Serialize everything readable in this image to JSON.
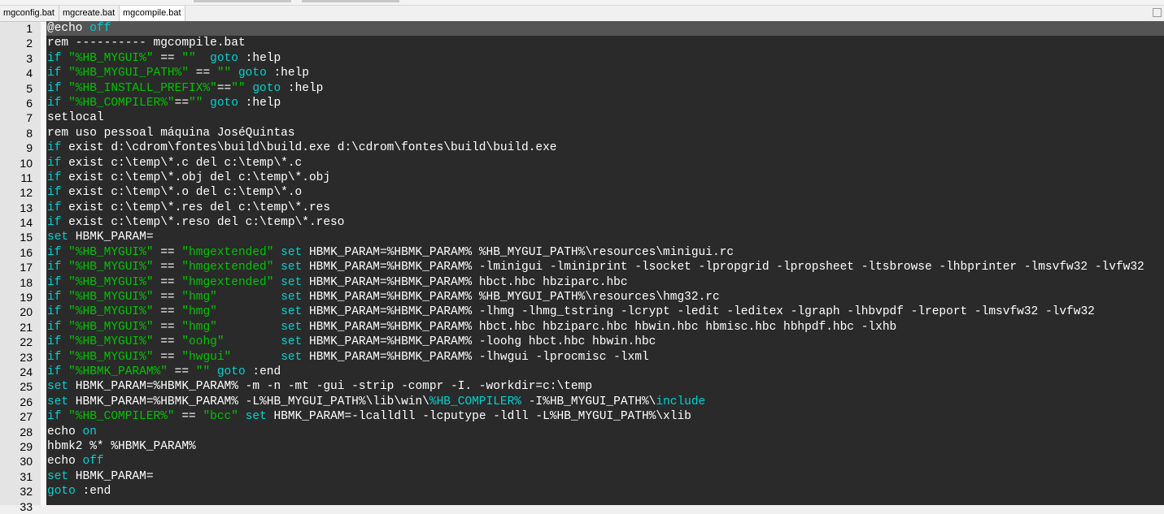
{
  "tabs": [
    {
      "label": "mgconfig.bat",
      "active": false
    },
    {
      "label": "mgcreate.bat",
      "active": false
    },
    {
      "label": "mgcompile.bat",
      "active": true
    }
  ],
  "colors": {
    "background": "#2a2a2a",
    "keyword": "#00d2d2",
    "string": "#00c400",
    "text": "#ffffff",
    "current_line": "#545454"
  },
  "editor": {
    "current_line": 1,
    "lines": [
      [
        [
          "w",
          "@echo "
        ],
        [
          "k",
          "off"
        ]
      ],
      [
        [
          "w",
          "rem ---------- mgcompile.bat"
        ]
      ],
      [
        [
          "k",
          "if"
        ],
        [
          "s",
          " \"%HB_MYGUI%\""
        ],
        [
          "w",
          " == "
        ],
        [
          "s",
          "\"\""
        ],
        [
          "w",
          "  "
        ],
        [
          "k",
          "goto"
        ],
        [
          "w",
          " :help"
        ]
      ],
      [
        [
          "k",
          "if"
        ],
        [
          "s",
          " \"%HB_MYGUI_PATH%\""
        ],
        [
          "w",
          " == "
        ],
        [
          "s",
          "\"\""
        ],
        [
          "w",
          " "
        ],
        [
          "k",
          "goto"
        ],
        [
          "w",
          " :help"
        ]
      ],
      [
        [
          "k",
          "if"
        ],
        [
          "s",
          " \"%HB_INSTALL_PREFIX%\""
        ],
        [
          "w",
          "=="
        ],
        [
          "s",
          "\"\""
        ],
        [
          "w",
          " "
        ],
        [
          "k",
          "goto"
        ],
        [
          "w",
          " :help"
        ]
      ],
      [
        [
          "k",
          "if"
        ],
        [
          "s",
          " \"%HB_COMPILER%\""
        ],
        [
          "w",
          "=="
        ],
        [
          "s",
          "\"\""
        ],
        [
          "w",
          " "
        ],
        [
          "k",
          "goto"
        ],
        [
          "w",
          " :help"
        ]
      ],
      [
        [
          "w",
          "setlocal"
        ]
      ],
      [
        [
          "w",
          "rem uso pessoal máquina JoséQuintas"
        ]
      ],
      [
        [
          "k",
          "if"
        ],
        [
          "w",
          " exist d:\\cdrom\\fontes\\build\\build.exe d:\\cdrom\\fontes\\build\\build.exe"
        ]
      ],
      [
        [
          "k",
          "if"
        ],
        [
          "w",
          " exist c:\\temp\\*.c del c:\\temp\\*.c"
        ]
      ],
      [
        [
          "k",
          "if"
        ],
        [
          "w",
          " exist c:\\temp\\*.obj del c:\\temp\\*.obj"
        ]
      ],
      [
        [
          "k",
          "if"
        ],
        [
          "w",
          " exist c:\\temp\\*.o del c:\\temp\\*.o"
        ]
      ],
      [
        [
          "k",
          "if"
        ],
        [
          "w",
          " exist c:\\temp\\*.res del c:\\temp\\*.res"
        ]
      ],
      [
        [
          "k",
          "if"
        ],
        [
          "w",
          " exist c:\\temp\\*.reso del c:\\temp\\*.reso"
        ]
      ],
      [
        [
          "k",
          "set"
        ],
        [
          "w",
          " HBMK_PARAM="
        ]
      ],
      [
        [
          "k",
          "if"
        ],
        [
          "s",
          " \"%HB_MYGUI%\""
        ],
        [
          "w",
          " == "
        ],
        [
          "s",
          "\"hmgextended\""
        ],
        [
          "w",
          " "
        ],
        [
          "k",
          "set"
        ],
        [
          "w",
          " HBMK_PARAM=%HBMK_PARAM% %HB_MYGUI_PATH%\\resources\\minigui.rc"
        ]
      ],
      [
        [
          "k",
          "if"
        ],
        [
          "s",
          " \"%HB_MYGUI%\""
        ],
        [
          "w",
          " == "
        ],
        [
          "s",
          "\"hmgextended\""
        ],
        [
          "w",
          " "
        ],
        [
          "k",
          "set"
        ],
        [
          "w",
          " HBMK_PARAM=%HBMK_PARAM% -lminigui -lminiprint -lsocket -lpropgrid -lpropsheet -ltsbrowse -lhbprinter -lmsvfw32 -lvfw32"
        ]
      ],
      [
        [
          "k",
          "if"
        ],
        [
          "s",
          " \"%HB_MYGUI%\""
        ],
        [
          "w",
          " == "
        ],
        [
          "s",
          "\"hmgextended\""
        ],
        [
          "w",
          " "
        ],
        [
          "k",
          "set"
        ],
        [
          "w",
          " HBMK_PARAM=%HBMK_PARAM% hbct.hbc hbziparc.hbc"
        ]
      ],
      [
        [
          "k",
          "if"
        ],
        [
          "s",
          " \"%HB_MYGUI%\""
        ],
        [
          "w",
          " == "
        ],
        [
          "s",
          "\"hmg\""
        ],
        [
          "w",
          "         "
        ],
        [
          "k",
          "set"
        ],
        [
          "w",
          " HBMK_PARAM=%HBMK_PARAM% %HB_MYGUI_PATH%\\resources\\hmg32.rc"
        ]
      ],
      [
        [
          "k",
          "if"
        ],
        [
          "s",
          " \"%HB_MYGUI%\""
        ],
        [
          "w",
          " == "
        ],
        [
          "s",
          "\"hmg\""
        ],
        [
          "w",
          "         "
        ],
        [
          "k",
          "set"
        ],
        [
          "w",
          " HBMK_PARAM=%HBMK_PARAM% -lhmg -lhmg_tstring -lcrypt -ledit -leditex -lgraph -lhbvpdf -lreport -lmsvfw32 -lvfw32"
        ]
      ],
      [
        [
          "k",
          "if"
        ],
        [
          "s",
          " \"%HB_MYGUI%\""
        ],
        [
          "w",
          " == "
        ],
        [
          "s",
          "\"hmg\""
        ],
        [
          "w",
          "         "
        ],
        [
          "k",
          "set"
        ],
        [
          "w",
          " HBMK_PARAM=%HBMK_PARAM% hbct.hbc hbziparc.hbc hbwin.hbc hbmisc.hbc hbhpdf.hbc -lxhb"
        ]
      ],
      [
        [
          "k",
          "if"
        ],
        [
          "s",
          " \"%HB_MYGUI%\""
        ],
        [
          "w",
          " == "
        ],
        [
          "s",
          "\"oohg\""
        ],
        [
          "w",
          "        "
        ],
        [
          "k",
          "set"
        ],
        [
          "w",
          " HBMK_PARAM=%HBMK_PARAM% -loohg hbct.hbc hbwin.hbc"
        ]
      ],
      [
        [
          "k",
          "if"
        ],
        [
          "s",
          " \"%HB_MYGUI%\""
        ],
        [
          "w",
          " == "
        ],
        [
          "s",
          "\"hwgui\""
        ],
        [
          "w",
          "       "
        ],
        [
          "k",
          "set"
        ],
        [
          "w",
          " HBMK_PARAM=%HBMK_PARAM% -lhwgui -lprocmisc -lxml"
        ]
      ],
      [
        [
          "k",
          "if"
        ],
        [
          "s",
          " \"%HBMK_PARAM%\""
        ],
        [
          "w",
          " == "
        ],
        [
          "s",
          "\"\""
        ],
        [
          "w",
          " "
        ],
        [
          "k",
          "goto"
        ],
        [
          "w",
          " :end"
        ]
      ],
      [
        [
          "k",
          "set"
        ],
        [
          "w",
          " HBMK_PARAM=%HBMK_PARAM% -m -n -mt -gui -strip -compr -I. -workdir=c:\\temp"
        ]
      ],
      [
        [
          "k",
          "set"
        ],
        [
          "w",
          " HBMK_PARAM=%HBMK_PARAM% -L%HB_MYGUI_PATH%\\lib\\win\\"
        ],
        [
          "k",
          "%HB_COMPILER%"
        ],
        [
          "w",
          " -I%HB_MYGUI_PATH%\\"
        ],
        [
          "k",
          "include"
        ]
      ],
      [
        [
          "k",
          "if"
        ],
        [
          "s",
          " \"%HB_COMPILER%\""
        ],
        [
          "w",
          " == "
        ],
        [
          "s",
          "\"bcc\""
        ],
        [
          "w",
          " "
        ],
        [
          "k",
          "set"
        ],
        [
          "w",
          " HBMK_PARAM=-lcalldll -lcputype -ldll -L%HB_MYGUI_PATH%\\xlib"
        ]
      ],
      [
        [
          "w",
          "echo "
        ],
        [
          "k",
          "on"
        ]
      ],
      [
        [
          "w",
          "hbmk2 %* %HBMK_PARAM%"
        ]
      ],
      [
        [
          "w",
          "echo "
        ],
        [
          "k",
          "off"
        ]
      ],
      [
        [
          "k",
          "set"
        ],
        [
          "w",
          " HBMK_PARAM="
        ]
      ],
      [
        [
          "k",
          "goto"
        ],
        [
          "w",
          " :end"
        ]
      ],
      []
    ]
  }
}
